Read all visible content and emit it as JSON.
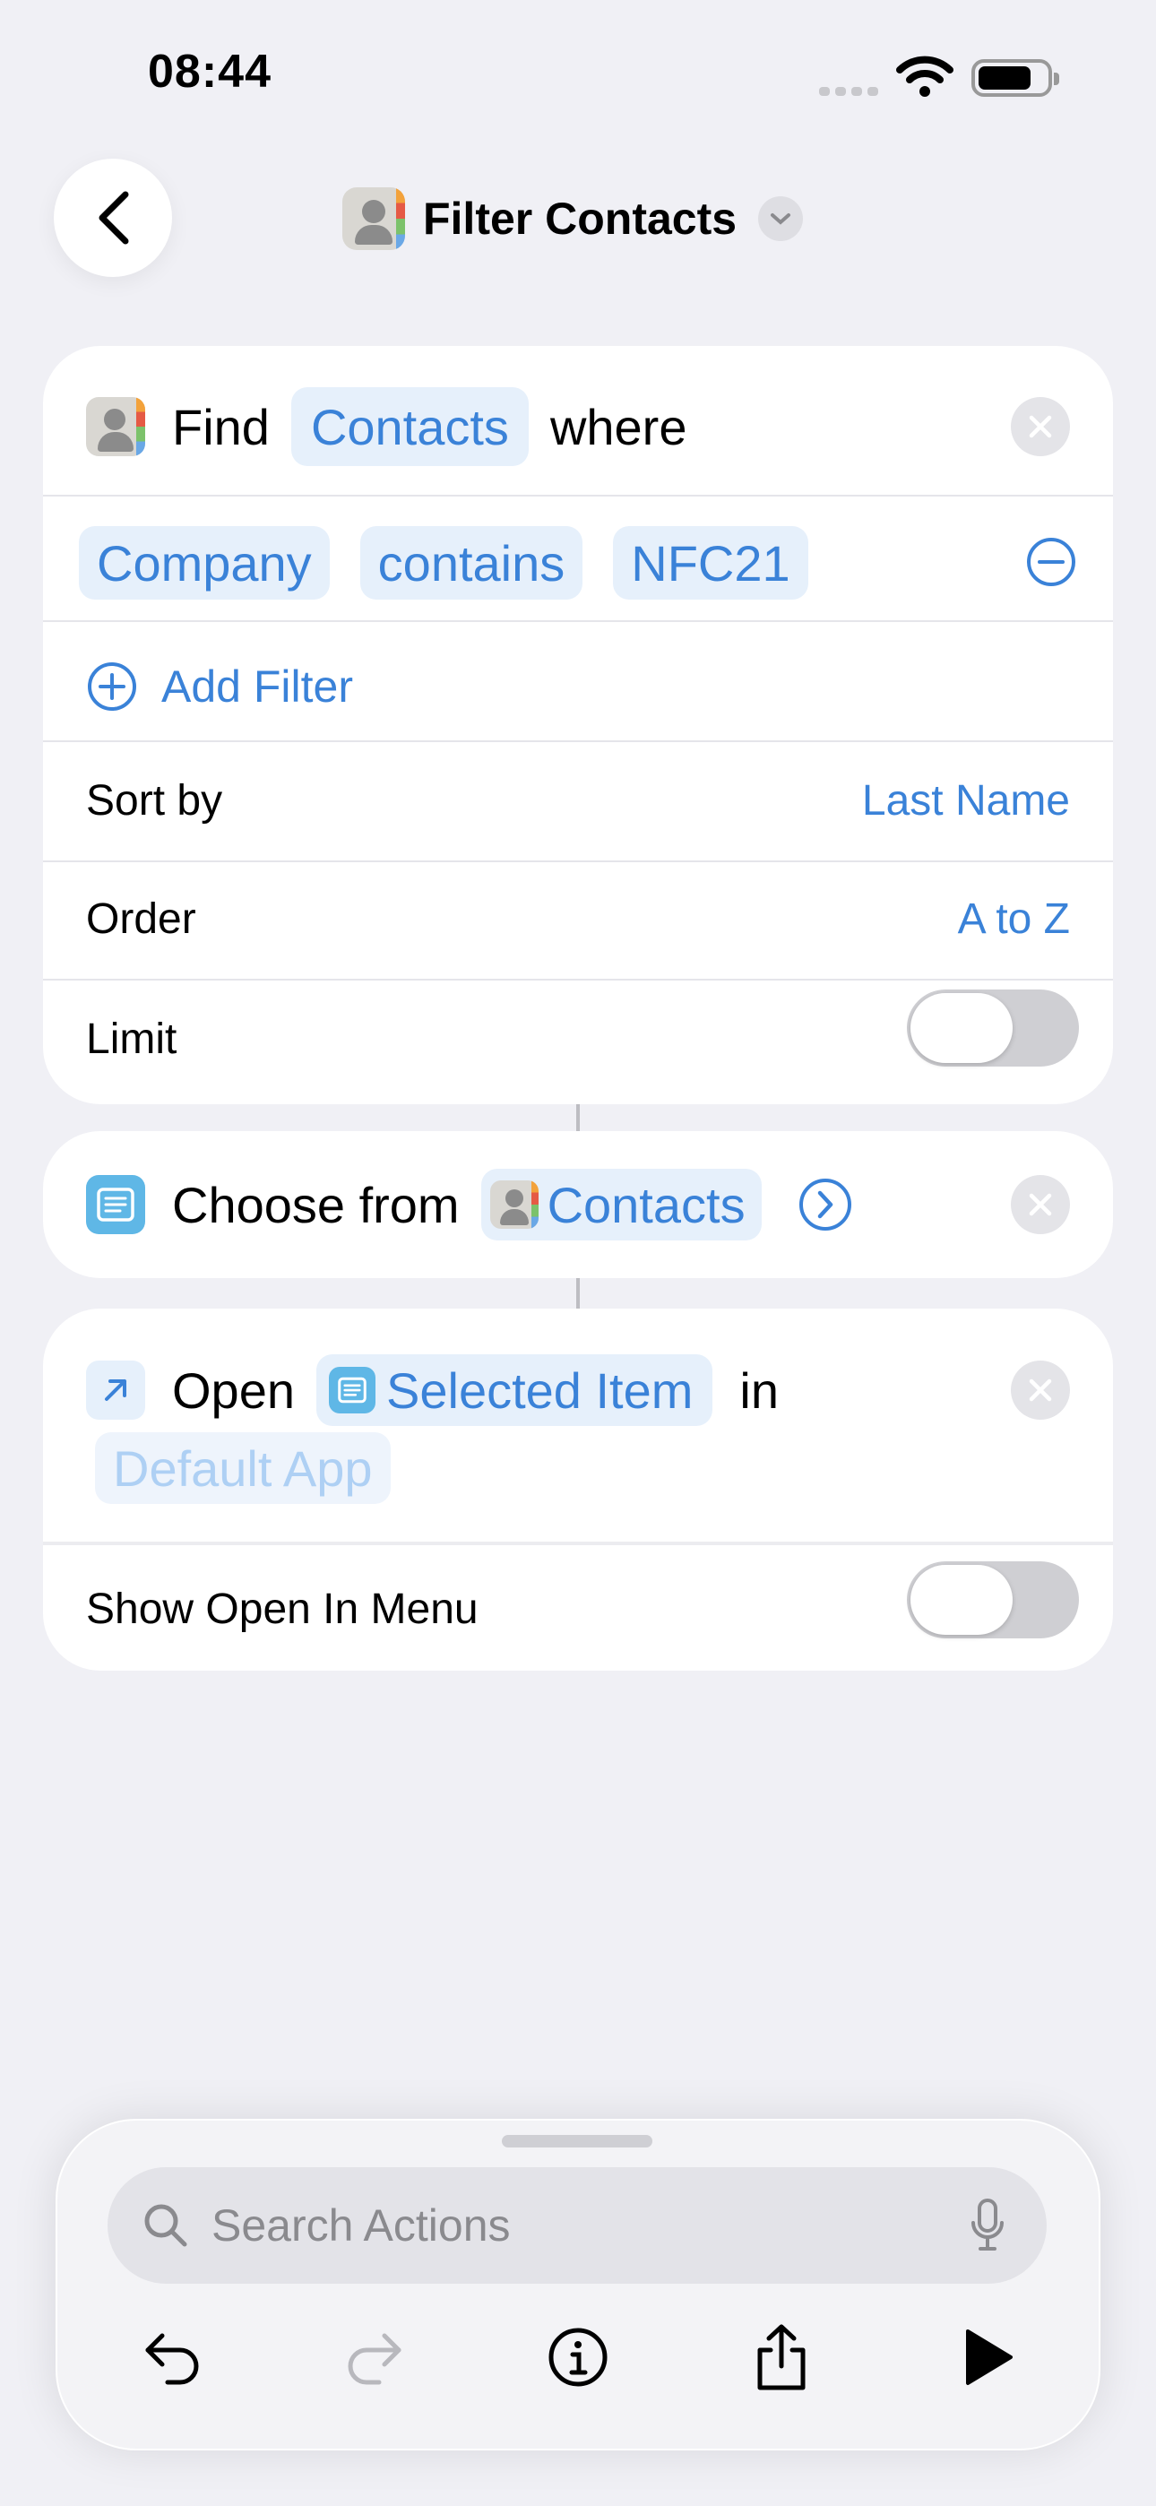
{
  "status_bar": {
    "time": "08:44"
  },
  "header": {
    "title": "Filter Contacts"
  },
  "find_card": {
    "find": "Find",
    "entity": "Contacts",
    "where": "where",
    "filter": {
      "field": "Company",
      "operator": "contains",
      "value": "NFC21"
    },
    "add_filter": "Add Filter",
    "sort_by_label": "Sort by",
    "sort_by_value": "Last Name",
    "order_label": "Order",
    "order_value": "A to Z",
    "limit_label": "Limit",
    "limit_on": false
  },
  "choose_card": {
    "label": "Choose from",
    "variable": "Contacts"
  },
  "open_card": {
    "open": "Open",
    "variable": "Selected Item",
    "in": "in",
    "app_placeholder": "Default App",
    "show_menu_label": "Show Open In Menu",
    "show_menu_on": false
  },
  "bottom_panel": {
    "search_placeholder": "Search Actions"
  },
  "colors": {
    "accent": "#3a82d8",
    "background": "#f0f0f5",
    "token_bg": "#e6f0fb"
  }
}
